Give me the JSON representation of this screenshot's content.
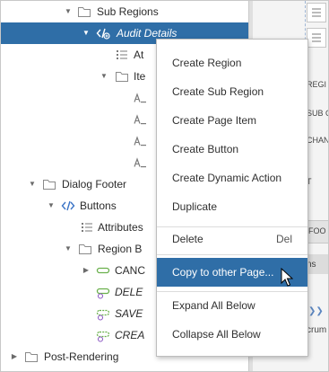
{
  "tree": {
    "sub_regions": "Sub Regions",
    "audit_details": "Audit Details",
    "at_partial": "At",
    "ite_partial": "Ite",
    "dialog_footer": "Dialog Footer",
    "buttons": "Buttons",
    "attributes": "Attributes",
    "region_b_partial": "Region B",
    "canc_partial": "CANC",
    "dele_partial": "DELE",
    "save_partial": "SAVE",
    "crea_partial": "CREA",
    "post_rendering": "Post-Rendering"
  },
  "context_menu": {
    "create_region": "Create Region",
    "create_sub_region": "Create Sub Region",
    "create_page_item": "Create Page Item",
    "create_button": "Create Button",
    "create_dynamic_action": "Create Dynamic Action",
    "duplicate": "Duplicate",
    "delete": "Delete",
    "delete_shortcut": "Del",
    "copy_to_other_page": "Copy to other Page...",
    "expand_all_below": "Expand All Below",
    "collapse_all_below": "Collapse All Below"
  },
  "right_panel": {
    "regi": "REGI",
    "sub_o": "SUB O",
    "chan": "CHAN",
    "t": "T",
    "foo": "FOO",
    "ns": "ns",
    "crum": "crum"
  },
  "colors": {
    "selection": "#2f6ea7",
    "region_folder": "#8a8a8a",
    "button_green": "#6ab04c",
    "code_blue": "#3b74c6"
  }
}
